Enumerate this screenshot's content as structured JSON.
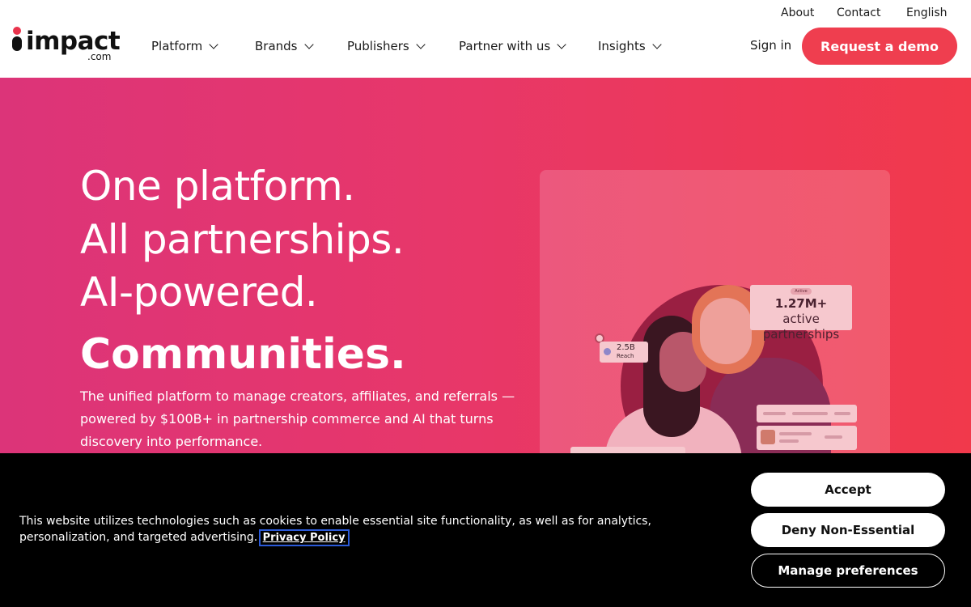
{
  "header": {
    "util_nav": [
      {
        "label": "About"
      },
      {
        "label": "Contact"
      },
      {
        "label": "English"
      }
    ],
    "logo": {
      "word": "impact",
      "suffix": ".com"
    },
    "main_nav": [
      {
        "label": "Platform"
      },
      {
        "label": "Brands"
      },
      {
        "label": "Publishers"
      },
      {
        "label": "Partner with us"
      },
      {
        "label": "Insights"
      }
    ],
    "signin_label": "Sign in",
    "demo_label": "Request a demo"
  },
  "hero": {
    "headline": [
      "One platform.",
      "All partnerships.",
      "AI-powered."
    ],
    "rotating_word": "Communities.",
    "subtext": "The unified platform to manage creators, affiliates, and referrals — powered by $100B+ in partnership commerce and AI that turns discovery into performance.",
    "visual": {
      "stat_badge": "Active",
      "stat_value": "1.27M+",
      "stat_label_1": "active",
      "stat_label_2": "partnerships",
      "reach_value": "2.5B",
      "reach_label": "Reach"
    }
  },
  "cookie_banner": {
    "text": "This website utilizes technologies such as cookies to enable essential site functionality, as well as for analytics, personalization, and targeted advertising.",
    "privacy_link": "Privacy Policy",
    "accept_label": "Accept",
    "deny_label": "Deny Non-Essential",
    "manage_label": "Manage preferences"
  },
  "colors": {
    "brand_red": "#ef3e4f",
    "hero_gradient_start": "#dc3479",
    "hero_gradient_end": "#f1394b",
    "banner_bg": "#000000"
  }
}
